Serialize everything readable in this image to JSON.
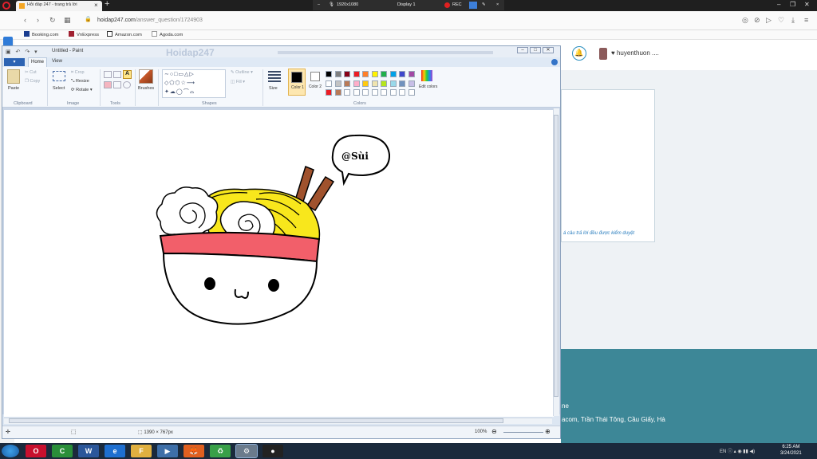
{
  "browser": {
    "tab_title": "Hỏi đáp 247 - trang trả lời",
    "url_host": "hoidap247.com",
    "url_path": "/answer_question/1724903",
    "bookmarks": [
      "Booking.com",
      "VnExpress",
      "Amazon.com",
      "Agoda.com"
    ]
  },
  "recorder": {
    "resolution": "1920x1080",
    "display": "Display 1",
    "rec_label": "REC"
  },
  "website": {
    "username": "♥ huyenthuon ....",
    "card_note": "á câu trả lời đều được kiểm duyệt",
    "footer_line1": "ne",
    "footer_line2": "acom, Trần Thái Tông, Cầu Giấy, Hà"
  },
  "paint": {
    "title": "Untitled - Paint",
    "ghost_logo": "Hoidap247",
    "tabs": {
      "file": "▾",
      "home": "Home",
      "view": "View"
    },
    "ribbon": {
      "paste": "Paste",
      "cut": "Cut",
      "copy": "Copy",
      "select": "Select",
      "crop": "Crop",
      "resize": "Resize",
      "rotate": "Rotate",
      "brushes": "Brushes",
      "outline": "Outline",
      "fill": "Fill",
      "size": "Size",
      "color1": "Color 1",
      "color2": "Color 2",
      "edit_colors": "Edit colors",
      "groups": {
        "clipboard": "Clipboard",
        "image": "Image",
        "tools": "Tools",
        "shapes": "Shapes",
        "colors": "Colors"
      }
    },
    "palette": [
      "#000000",
      "#7f7f7f",
      "#880015",
      "#ed1c24",
      "#ff7f27",
      "#fff200",
      "#22b14c",
      "#00a2e8",
      "#3f48cc",
      "#a349a4",
      "#ffffff",
      "#c3c3c3",
      "#b97a57",
      "#ffaec9",
      "#ffc90e",
      "#efe4b0",
      "#b5e61d",
      "#99d9ea",
      "#7092be",
      "#c8bfe7",
      "#ed1c24",
      "#b97a57",
      "#ffffff",
      "#ffffff",
      "#ffffff",
      "#ffffff",
      "#ffffff",
      "#ffffff",
      "#ffffff",
      "#ffffff"
    ],
    "drawing_caption": "@Sùi",
    "status_dims": "1390 × 767px",
    "zoom": "100%"
  },
  "taskbar": {
    "apps": [
      "O",
      "C",
      "W",
      "e",
      "F",
      "▶",
      "🦊",
      "♻",
      "⚙",
      "●"
    ],
    "tray": "EN",
    "time": "6:25 AM",
    "date": "3/24/2021"
  }
}
